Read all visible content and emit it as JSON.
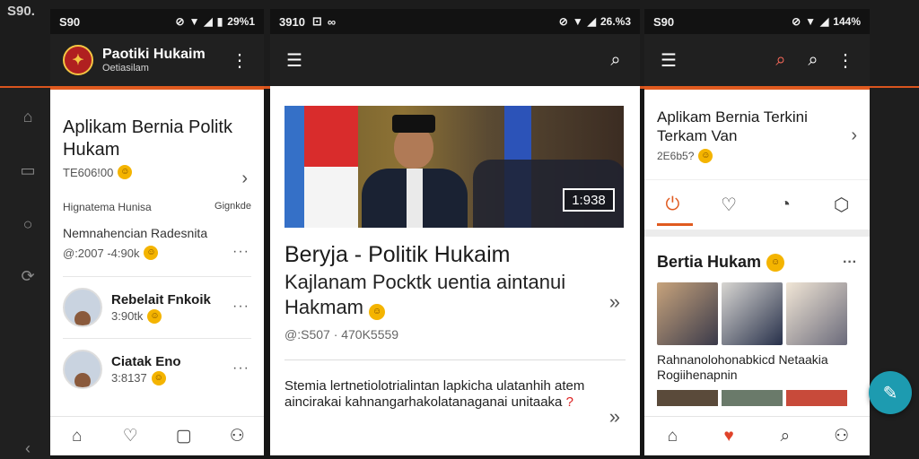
{
  "background": {
    "status_time": "S90.",
    "rail_icons": [
      "home-outline-icon",
      "square-icon",
      "search-icon",
      "sync-icon",
      "back-arrow-icon"
    ]
  },
  "phone1": {
    "status": {
      "time": "S90",
      "right": "29%1"
    },
    "appbar": {
      "title": "Paotiki Hukaim",
      "subtitle": "Oetiasilam"
    },
    "card": {
      "title": "Aplikam Bernia Politk Hukam",
      "meta": "TE606!00",
      "line1_left": "Hignatema Hunisa",
      "line1_right": "Gignkde",
      "line2": "Nemnahencian Radesnita",
      "line3": "@:2007 -4:90k"
    },
    "people": [
      {
        "name": "Rebelait Fnkoik",
        "meta": "3:90tk"
      },
      {
        "name": "Ciatak Eno",
        "meta": "3:8137"
      }
    ]
  },
  "phone2": {
    "status": {
      "time": "3910",
      "right": "26.%3"
    },
    "hero_badge": "1:938",
    "headline": "Beryja - Politik Hukaim",
    "sub": "Kajlanam Pocktk uentia aintanui Hakmam",
    "meta": "@:S507  ·  470K5559",
    "text": "Stemia lertnetiolotrialintan lapkicha ulatanhih atem aincirakai kahnangarhakolatanaganai unitaaka"
  },
  "phone3": {
    "status": {
      "time": "S90",
      "right": "144%"
    },
    "card_title": "Aplikam Bernia Terkini Terkam Van",
    "card_meta": "2E6b5?",
    "section_title": "Bertia Hukam",
    "caption": "Rahnanolohonabkicd Netaakia Rogiihenapnin"
  },
  "colors": {
    "accent": "#e05a1f",
    "appbar": "#202020",
    "fab": "#1d9bb0"
  }
}
